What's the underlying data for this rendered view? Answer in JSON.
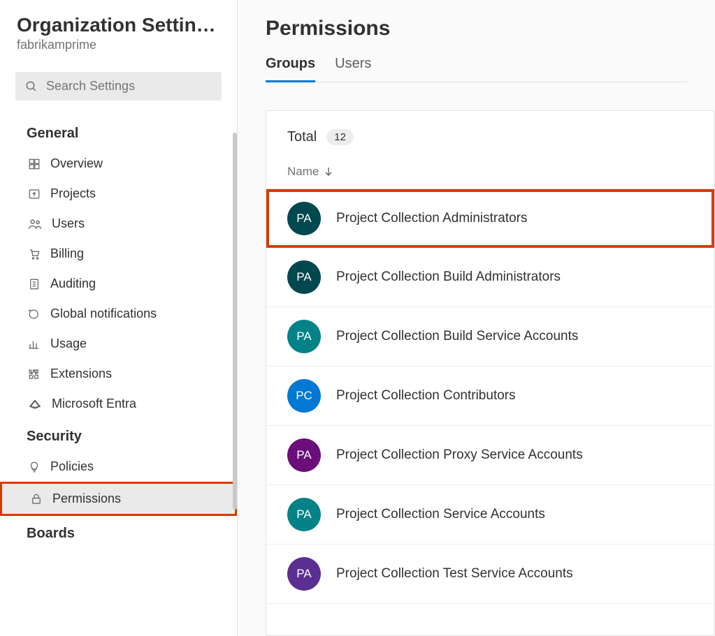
{
  "sidebar": {
    "title": "Organization Settin…",
    "subtitle": "fabrikamprime",
    "search_placeholder": "Search Settings",
    "sections": [
      {
        "heading": "General",
        "items": [
          {
            "label": "Overview",
            "icon": "grid"
          },
          {
            "label": "Projects",
            "icon": "upload"
          },
          {
            "label": "Users",
            "icon": "users"
          },
          {
            "label": "Billing",
            "icon": "cart"
          },
          {
            "label": "Auditing",
            "icon": "list"
          },
          {
            "label": "Global notifications",
            "icon": "chat"
          },
          {
            "label": "Usage",
            "icon": "bar-chart"
          },
          {
            "label": "Extensions",
            "icon": "puzzle"
          },
          {
            "label": "Microsoft Entra",
            "icon": "entra"
          }
        ]
      },
      {
        "heading": "Security",
        "items": [
          {
            "label": "Policies",
            "icon": "bulb"
          },
          {
            "label": "Permissions",
            "icon": "lock",
            "selected": true,
            "highlight": true
          }
        ]
      },
      {
        "heading": "Boards",
        "items": []
      }
    ]
  },
  "main": {
    "title": "Permissions",
    "tabs": [
      {
        "label": "Groups",
        "active": true
      },
      {
        "label": "Users",
        "active": false
      }
    ],
    "total_label": "Total",
    "total_count": "12",
    "column_header": "Name",
    "groups": [
      {
        "initials": "PA",
        "name": "Project Collection Administrators",
        "color": "#00484f",
        "highlight": true
      },
      {
        "initials": "PA",
        "name": "Project Collection Build Administrators",
        "color": "#00484f"
      },
      {
        "initials": "PA",
        "name": "Project Collection Build Service Accounts",
        "color": "#038387"
      },
      {
        "initials": "PC",
        "name": "Project Collection Contributors",
        "color": "#0078d4"
      },
      {
        "initials": "PA",
        "name": "Project Collection Proxy Service Accounts",
        "color": "#6b0e7a"
      },
      {
        "initials": "PA",
        "name": "Project Collection Service Accounts",
        "color": "#038387"
      },
      {
        "initials": "PA",
        "name": "Project Collection Test Service Accounts",
        "color": "#5c2e91"
      }
    ]
  }
}
